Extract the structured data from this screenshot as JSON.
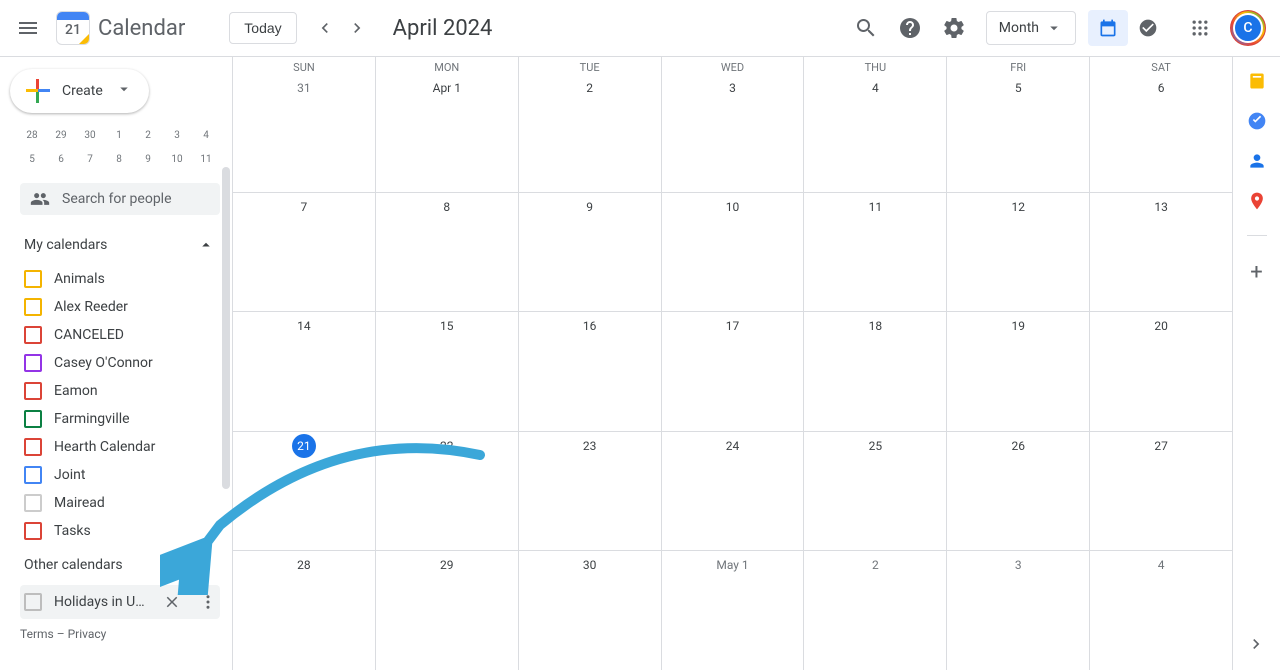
{
  "header": {
    "logo_text": "Calendar",
    "today_label": "Today",
    "month_title": "April 2024",
    "view_label": "Month",
    "avatar_letter": "C"
  },
  "create_label": "Create",
  "mini_calendar": {
    "rows": [
      [
        "28",
        "29",
        "30",
        "1",
        "2",
        "3",
        "4"
      ],
      [
        "5",
        "6",
        "7",
        "8",
        "9",
        "10",
        "11"
      ]
    ]
  },
  "search_people_placeholder": "Search for people",
  "sections": {
    "my_calendars": "My calendars",
    "other_calendars": "Other calendars"
  },
  "my_calendars": [
    {
      "label": "Animals",
      "color": "#f4b400"
    },
    {
      "label": "Alex Reeder",
      "color": "#f4b400"
    },
    {
      "label": "CANCELED",
      "color": "#db4437"
    },
    {
      "label": "Casey O'Connor",
      "color": "#9334e6"
    },
    {
      "label": "Eamon",
      "color": "#db4437"
    },
    {
      "label": "Farmingville",
      "color": "#0b8043"
    },
    {
      "label": "Hearth Calendar",
      "color": "#db4437"
    },
    {
      "label": "Joint",
      "color": "#4285f4"
    },
    {
      "label": "Mairead",
      "color": "#cccccc"
    },
    {
      "label": "Tasks",
      "color": "#db4437"
    }
  ],
  "other_calendars": [
    {
      "label": "Holidays in Unit…",
      "color": "#bdbdbd"
    }
  ],
  "footer": {
    "terms": "Terms",
    "sep": " – ",
    "privacy": "Privacy"
  },
  "grid": {
    "dow": [
      "SUN",
      "MON",
      "TUE",
      "WED",
      "THU",
      "FRI",
      "SAT"
    ],
    "weeks": [
      [
        {
          "n": "31",
          "faded": true
        },
        {
          "n": "Apr 1",
          "monthstart": true
        },
        {
          "n": "2"
        },
        {
          "n": "3"
        },
        {
          "n": "4"
        },
        {
          "n": "5"
        },
        {
          "n": "6"
        }
      ],
      [
        {
          "n": "7"
        },
        {
          "n": "8"
        },
        {
          "n": "9"
        },
        {
          "n": "10"
        },
        {
          "n": "11"
        },
        {
          "n": "12"
        },
        {
          "n": "13"
        }
      ],
      [
        {
          "n": "14"
        },
        {
          "n": "15"
        },
        {
          "n": "16"
        },
        {
          "n": "17"
        },
        {
          "n": "18"
        },
        {
          "n": "19"
        },
        {
          "n": "20"
        }
      ],
      [
        {
          "n": "21",
          "today": true
        },
        {
          "n": "22"
        },
        {
          "n": "23"
        },
        {
          "n": "24"
        },
        {
          "n": "25"
        },
        {
          "n": "26"
        },
        {
          "n": "27"
        }
      ],
      [
        {
          "n": "28"
        },
        {
          "n": "29"
        },
        {
          "n": "30"
        },
        {
          "n": "May 1",
          "monthstart": true,
          "faded": true
        },
        {
          "n": "2",
          "faded": true
        },
        {
          "n": "3",
          "faded": true
        },
        {
          "n": "4",
          "faded": true
        }
      ]
    ]
  }
}
